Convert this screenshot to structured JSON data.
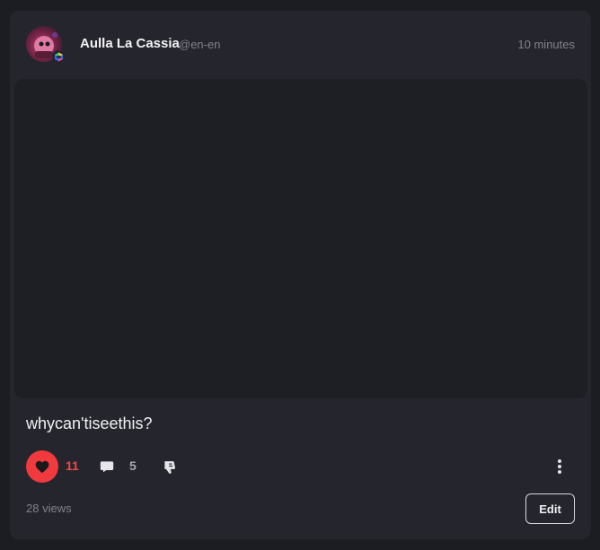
{
  "post": {
    "author_name": "Aulla La Cassia",
    "author_handle": "@en-en",
    "time": "10 minutes",
    "caption": "whycan'tiseethis?",
    "likes": "11",
    "comments": "5",
    "views": "28 views",
    "edit_label": "Edit"
  },
  "icons": {
    "like": "heart-icon",
    "comment": "comment-icon",
    "dislike": "thumbs-down-icon",
    "more": "more-vertical-icon",
    "badge": "hexagon-badge-icon"
  },
  "colors": {
    "background": "#1c1d22",
    "card": "#25262d",
    "media": "#1e1f25",
    "like_accent": "#f03a3e",
    "muted_text": "#80828c"
  }
}
